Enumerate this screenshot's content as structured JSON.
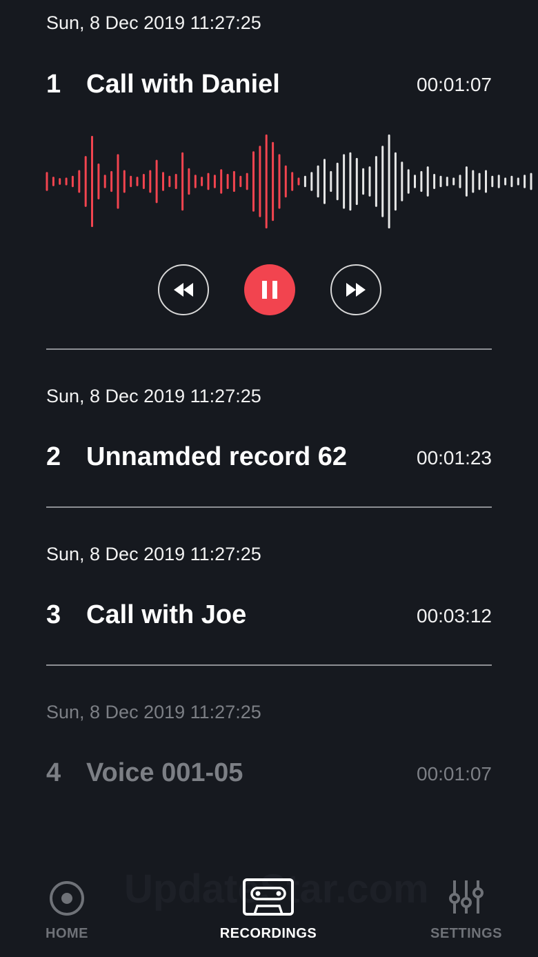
{
  "colors": {
    "background": "#16191f",
    "accent": "#f2444f",
    "text": "#ffffff",
    "muted": "#7c7f85"
  },
  "recordings": [
    {
      "index": "1",
      "date": "Sun, 8 Dec 2019 11:27:25",
      "title": "Call with Daniel",
      "duration": "00:01:07"
    },
    {
      "index": "2",
      "date": "Sun, 8 Dec 2019 11:27:25",
      "title": "Unnamded record 62",
      "duration": "00:01:23"
    },
    {
      "index": "3",
      "date": "Sun, 8 Dec 2019 11:27:25",
      "title": "Call with Joe",
      "duration": "00:03:12"
    },
    {
      "index": "4",
      "date": "Sun, 8 Dec 2019 11:27:25",
      "title": "Voice 001-05",
      "duration": "00:01:07"
    }
  ],
  "player": {
    "progress": 0.52,
    "controls": {
      "rewind_icon": "rewind-icon",
      "pause_icon": "pause-icon",
      "forward_icon": "fast-forward-icon"
    },
    "waveform": [
      0.18,
      0.08,
      0.05,
      0.06,
      0.1,
      0.22,
      0.52,
      0.95,
      0.36,
      0.12,
      0.2,
      0.56,
      0.22,
      0.1,
      0.08,
      0.14,
      0.22,
      0.44,
      0.18,
      0.1,
      0.14,
      0.6,
      0.26,
      0.12,
      0.08,
      0.16,
      0.12,
      0.24,
      0.14,
      0.2,
      0.1,
      0.16,
      0.62,
      0.74,
      0.98,
      0.82,
      0.56,
      0.32,
      0.18,
      0.06,
      0.1,
      0.18,
      0.32,
      0.46,
      0.2,
      0.38,
      0.56,
      0.6,
      0.48,
      0.26,
      0.3,
      0.52,
      0.74,
      0.98,
      0.6,
      0.4,
      0.24,
      0.12,
      0.2,
      0.3,
      0.14,
      0.1,
      0.08,
      0.06,
      0.12,
      0.3,
      0.22,
      0.16,
      0.22,
      0.1,
      0.12,
      0.06,
      0.1,
      0.06,
      0.12,
      0.16
    ]
  },
  "watermark": "UpdateStar.com",
  "nav": {
    "home": {
      "label": "HOME",
      "icon": "record-icon"
    },
    "recordings": {
      "label": "RECORDINGS",
      "icon": "cassette-icon"
    },
    "settings": {
      "label": "SETTINGS",
      "icon": "sliders-icon"
    }
  }
}
